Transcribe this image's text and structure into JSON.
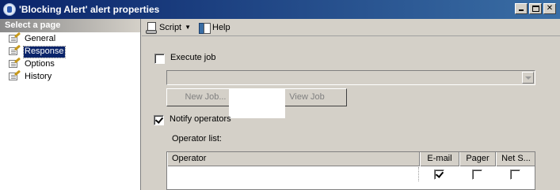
{
  "window": {
    "title": "'Blocking Alert' alert properties"
  },
  "left_panel": {
    "header": "Select a page",
    "items": [
      {
        "label": "General",
        "selected": false
      },
      {
        "label": "Response",
        "selected": true
      },
      {
        "label": "Options",
        "selected": false
      },
      {
        "label": "History",
        "selected": false
      }
    ]
  },
  "toolbar": {
    "script_label": "Script",
    "help_label": "Help"
  },
  "response": {
    "execute_job_label": "Execute job",
    "execute_job_checked": false,
    "job_select_value": "",
    "new_job_label": "New Job...",
    "view_job_label": "View Job",
    "notify_operators_label": "Notify operators",
    "notify_operators_checked": true,
    "operator_list_label": "Operator list:",
    "grid": {
      "columns": [
        "Operator",
        "E-mail",
        "Pager",
        "Net S..."
      ],
      "rows": [
        {
          "operator": "",
          "email": true,
          "pager": false,
          "net_send": false
        }
      ]
    }
  },
  "icons": {
    "window": "sql-alert-icon",
    "page_item": "property-page-icon",
    "script": "script-icon",
    "help": "help-icon"
  }
}
